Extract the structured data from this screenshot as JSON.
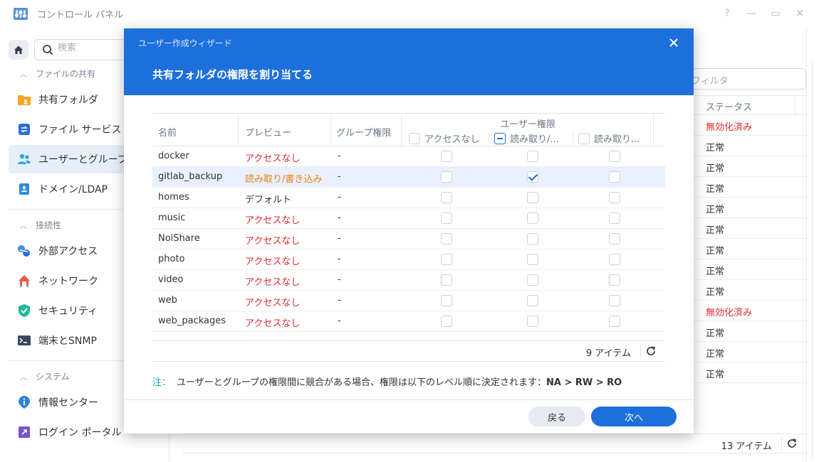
{
  "window": {
    "title": "コントロール パネル",
    "controls": [
      "?",
      "—",
      "▭",
      "✕"
    ]
  },
  "sidebar": {
    "search_placeholder": "検索",
    "sections": [
      {
        "label": "ファイルの共有",
        "items": [
          {
            "label": "共有フォルダ",
            "icon": "shared-folder-icon"
          },
          {
            "label": "ファイル サービス",
            "icon": "file-services-icon"
          },
          {
            "label": "ユーザーとグループ",
            "icon": "users-groups-icon",
            "active": true
          },
          {
            "label": "ドメイン/LDAP",
            "icon": "domain-ldap-icon"
          }
        ]
      },
      {
        "label": "接続性",
        "items": [
          {
            "label": "外部アクセス",
            "icon": "external-access-icon"
          },
          {
            "label": "ネットワーク",
            "icon": "network-icon"
          },
          {
            "label": "セキュリティ",
            "icon": "security-shield-icon"
          },
          {
            "label": "端末とSNMP",
            "icon": "terminal-icon"
          }
        ]
      },
      {
        "label": "システム",
        "items": [
          {
            "label": "情報センター",
            "icon": "info-center-icon"
          },
          {
            "label": "ログイン ポータル",
            "icon": "login-portal-icon"
          }
        ]
      }
    ]
  },
  "background": {
    "filter_placeholder": "フィルタ",
    "status_header": "ステータス",
    "statuses": [
      "無効化済み",
      "正常",
      "正常",
      "正常",
      "正常",
      "正常",
      "正常",
      "正常",
      "正常",
      "無効化済み",
      "正常",
      "正常",
      "正常"
    ],
    "footer_count": "13 アイテム"
  },
  "modal": {
    "wizard_title": "ユーザー作成ウィザード",
    "step_title": "共有フォルダの権限を割り当てる",
    "columns": {
      "name": "名前",
      "preview": "プレビュー",
      "group_perm": "グループ権限",
      "user_perm": "ユーザー権限",
      "no_access": "アクセスなし",
      "read_write": "読み取り/...",
      "read_only": "読み取り..."
    },
    "rows": [
      {
        "name": "docker",
        "preview": "アクセスなし",
        "preview_kind": "na",
        "group": "-",
        "no_access": false,
        "read_write": false,
        "read_only": false
      },
      {
        "name": "gitlab_backup",
        "preview": "読み取り/書き込み",
        "preview_kind": "rw",
        "group": "-",
        "no_access": false,
        "read_write": true,
        "read_only": false,
        "selected": true
      },
      {
        "name": "homes",
        "preview": "デフォルト",
        "preview_kind": "def",
        "group": "-",
        "no_access": false,
        "read_write": false,
        "read_only": false
      },
      {
        "name": "music",
        "preview": "アクセスなし",
        "preview_kind": "na",
        "group": "-",
        "no_access": false,
        "read_write": false,
        "read_only": false
      },
      {
        "name": "NoiShare",
        "preview": "アクセスなし",
        "preview_kind": "na",
        "group": "-",
        "no_access": false,
        "read_write": false,
        "read_only": false
      },
      {
        "name": "photo",
        "preview": "アクセスなし",
        "preview_kind": "na",
        "group": "-",
        "no_access": false,
        "read_write": false,
        "read_only": false
      },
      {
        "name": "video",
        "preview": "アクセスなし",
        "preview_kind": "na",
        "group": "-",
        "no_access": false,
        "read_write": false,
        "read_only": false
      },
      {
        "name": "web",
        "preview": "アクセスなし",
        "preview_kind": "na",
        "group": "-",
        "no_access": false,
        "read_write": false,
        "read_only": false
      },
      {
        "name": "web_packages",
        "preview": "アクセスなし",
        "preview_kind": "na",
        "group": "-",
        "no_access": false,
        "read_write": false,
        "read_only": false
      }
    ],
    "item_count": "9 アイテム",
    "note_label": "注：",
    "note_text": "ユーザーとグループの権限間に競合がある場合、権限は以下のレベル順に決定されます：",
    "note_order": "NA > RW > RO",
    "back_button": "戻る",
    "next_button": "次へ"
  },
  "colors": {
    "accent": "#1d6fdc",
    "no_access": "#e0282f",
    "read_write": "#ef7d0f",
    "note_label": "#1aa2b0"
  }
}
